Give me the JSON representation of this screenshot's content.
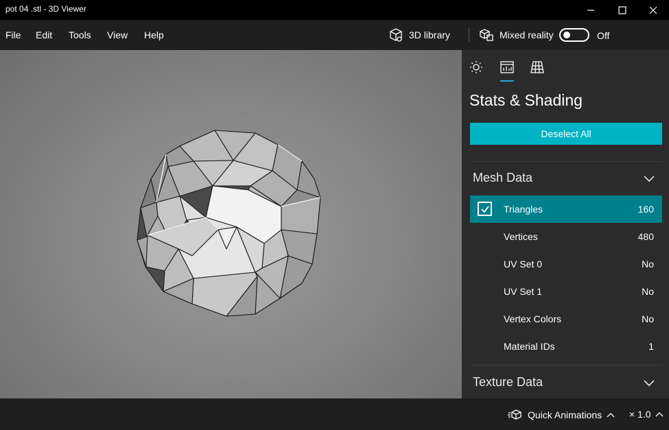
{
  "window": {
    "title": "pot 04 .stl - 3D Viewer",
    "minimize_icon": "minimize-icon",
    "maximize_icon": "maximize-icon",
    "close_icon": "close-icon"
  },
  "menu": {
    "items": [
      "File",
      "Edit",
      "Tools",
      "View",
      "Help"
    ],
    "library_label": "3D library",
    "library_icon": "cube-icon",
    "mixed_reality_label": "Mixed reality",
    "mixed_reality_icon": "mixed-reality-icon",
    "mixed_reality_state": "Off"
  },
  "panel": {
    "tabs": [
      "lighting-icon",
      "stats-icon",
      "grid-icon"
    ],
    "active_tab": 1,
    "title": "Stats & Shading",
    "deselect_label": "Deselect All",
    "mesh_section": {
      "title": "Mesh Data",
      "rows": [
        {
          "label": "Triangles",
          "value": "160",
          "checked": true
        },
        {
          "label": "Vertices",
          "value": "480"
        },
        {
          "label": "UV Set 0",
          "value": "No"
        },
        {
          "label": "UV Set 1",
          "value": "No"
        },
        {
          "label": "Vertex Colors",
          "value": "No"
        },
        {
          "label": "Material IDs",
          "value": "1"
        }
      ]
    },
    "texture_section": {
      "title": "Texture Data"
    }
  },
  "status": {
    "quick_animations_label": "Quick Animations",
    "speed_label": "× 1.0"
  },
  "colors": {
    "accent": "#00b4c5",
    "selected_row": "#00808c",
    "panel_bg": "#2b2b2b"
  }
}
